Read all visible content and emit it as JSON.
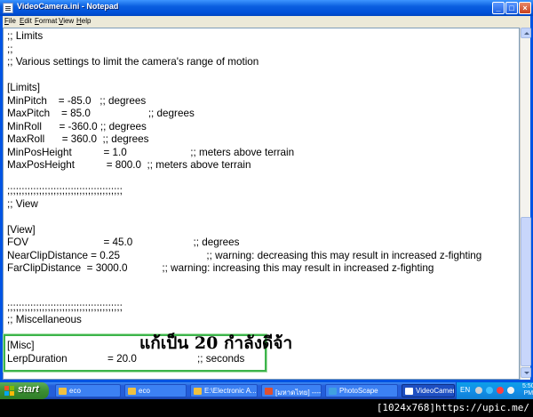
{
  "window": {
    "title": "VideoCamera.ini - Notepad",
    "controls": {
      "minimize": "_",
      "maximize": "□",
      "close": "×"
    }
  },
  "menu": {
    "items": [
      {
        "label": "File",
        "u": "F",
        "rest": "ile"
      },
      {
        "label": "Edit",
        "u": "E",
        "rest": "dit"
      },
      {
        "label": "Format",
        "u": "F",
        "rest": "ormat"
      },
      {
        "label": "View",
        "u": "V",
        "rest": "iew"
      },
      {
        "label": "Help",
        "u": "H",
        "rest": "elp"
      }
    ]
  },
  "editor": {
    "lines": [
      ";; Limits",
      ";;",
      ";; Various settings to limit the camera's range of motion",
      "",
      "[Limits]",
      "MinPitch    = -85.0   ;; degrees",
      "MaxPitch    = 85.0                    ;; degrees",
      "MinRoll      = -360.0 ;; degrees",
      "MaxRoll      = 360.0  ;; degrees",
      "MinPosHeight           = 1.0                      ;; meters above terrain",
      "MaxPosHeight           = 800.0  ;; meters above terrain",
      "",
      ";;;;;;;;;;;;;;;;;;;;;;;;;;;;;;;;;;;;;;;;",
      ";; View",
      "",
      "[View]",
      "FOV                          = 45.0                     ;; degrees",
      "NearClipDistance = 0.25                              ;; warning: decreasing this may result in increased z-fighting",
      "FarClipDistance  = 3000.0            ;; warning: increasing this may result in increased z-fighting",
      "",
      "",
      ";;;;;;;;;;;;;;;;;;;;;;;;;;;;;;;;;;;;;;;;",
      ";; Miscellaneous",
      "",
      "[Misc]",
      "LerpDuration              = 20.0                     ;; seconds"
    ]
  },
  "annotation": {
    "text": "แก้เป็น  20  กำลังดีจ้า",
    "color": "#3cb44b"
  },
  "taskbar": {
    "start_label": "start",
    "tasks": [
      {
        "label": "eco",
        "icon_color": "#f0c040",
        "active": false
      },
      {
        "label": "eco",
        "icon_color": "#f0c040",
        "active": false
      },
      {
        "label": "E:\\Electronic A...",
        "icon_color": "#f0c040",
        "active": false
      },
      {
        "label": "[มหาดไทย] ------ ...",
        "icon_color": "#e05030",
        "active": false
      },
      {
        "label": "PhotoScape",
        "icon_color": "#40a0e0",
        "active": false
      },
      {
        "label": "VideoCamera.i...",
        "icon_color": "#ffffff",
        "active": true
      }
    ],
    "tray": {
      "language": "EN",
      "clock_time": "5:50",
      "clock_period": "PM"
    }
  },
  "watermark": "[1024x768]https://upic.me/"
}
